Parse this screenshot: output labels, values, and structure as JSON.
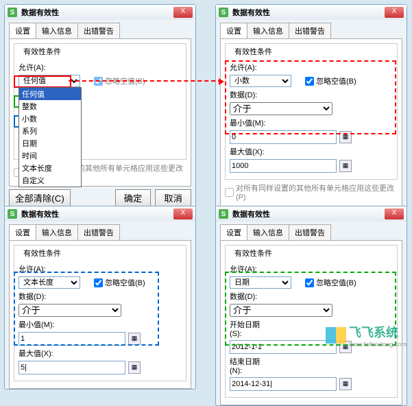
{
  "window": {
    "title": "数据有效性",
    "close": "X",
    "icon": "S"
  },
  "tabs": {
    "t1": "设置",
    "t2": "输入信息",
    "t3": "出错警告"
  },
  "group": {
    "validity": "有效性条件",
    "allow": "允许(A):",
    "data": "数据(D):",
    "min": "最小值(M):",
    "max": "最大值(X):",
    "start": "开始日期(S):",
    "end": "结束日期(N):"
  },
  "check": {
    "ignore": "忽略空值(B)",
    "apply": "对所有同样设置的其他所有单元格应用这些更改(P)"
  },
  "buttons": {
    "clear": "全部清除(C)",
    "ok": "确定",
    "cancel": "取消"
  },
  "dropdown": {
    "any": "任何值",
    "whole": "整数",
    "decimal": "小数",
    "list": "系列",
    "date": "日期",
    "time": "时间",
    "textlen": "文本长度",
    "custom": "自定义",
    "between": "介于"
  },
  "tl": {
    "allow": "任何值"
  },
  "tr": {
    "allow": "小数",
    "data": "介于",
    "min": "0",
    "max": "1000"
  },
  "bl": {
    "allow": "文本长度",
    "data": "介于",
    "min": "1",
    "max": "5|"
  },
  "br": {
    "allow": "日期",
    "data": "介于",
    "start": "2012-1-1",
    "end": "2014-12-31|"
  },
  "watermark": "飞飞系统",
  "wurl": "www.feifeixitong.com"
}
